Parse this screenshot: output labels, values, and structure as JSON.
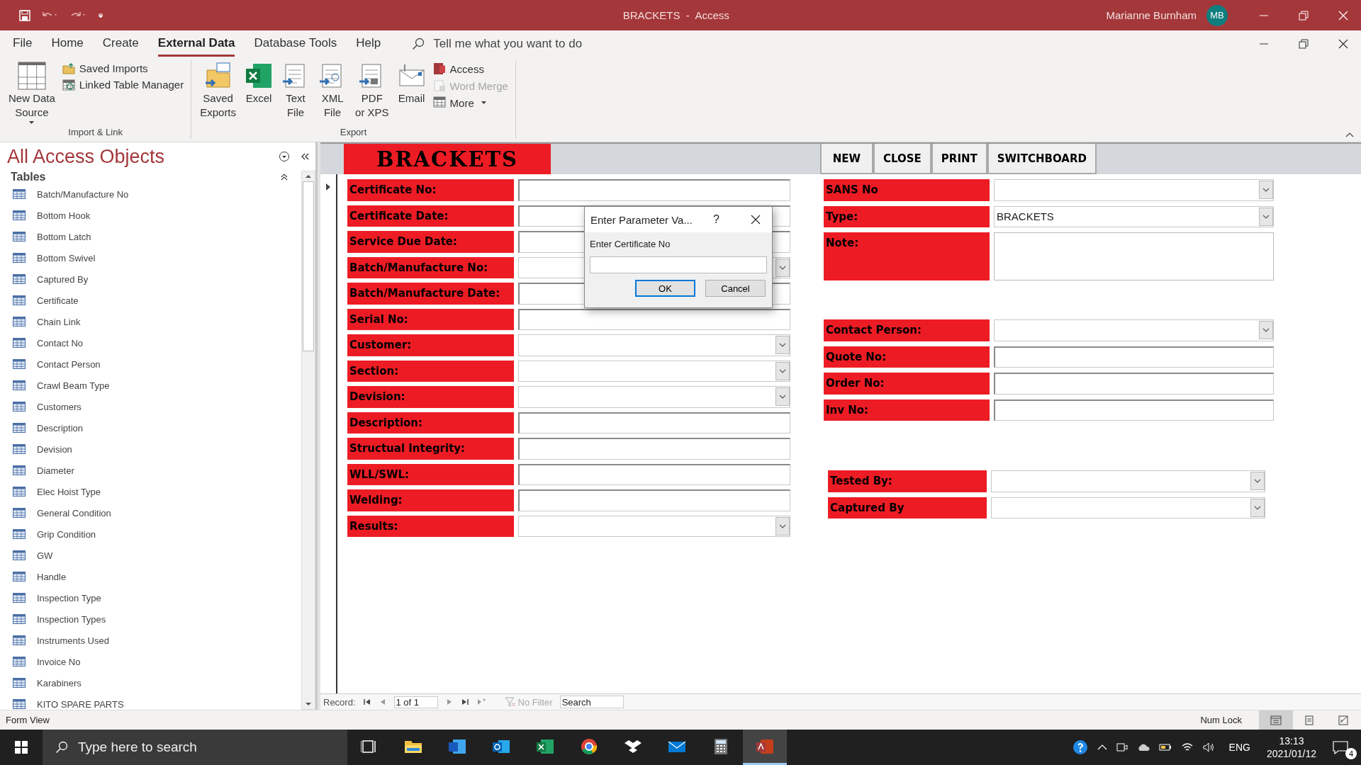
{
  "window": {
    "title": "BRACKETS  -  Access",
    "user": "Marianne Burnham",
    "user_initials": "MB"
  },
  "ribbon_tabs": [
    {
      "label": "File",
      "selected": false
    },
    {
      "label": "Home",
      "selected": false
    },
    {
      "label": "Create",
      "selected": false
    },
    {
      "label": "External Data",
      "selected": true
    },
    {
      "label": "Database Tools",
      "selected": false
    },
    {
      "label": "Help",
      "selected": false
    }
  ],
  "tell_me": {
    "placeholder": "Tell me what you want to do"
  },
  "ribbon_groups": [
    {
      "label": "Import & Link",
      "items": [
        {
          "label": "New Data\nSource",
          "kind": "large",
          "dropdown": true,
          "disabled": false
        },
        {
          "label": "Saved Imports",
          "kind": "small",
          "dropdown": false,
          "disabled": false
        },
        {
          "label": "Linked Table Manager",
          "kind": "small",
          "dropdown": false,
          "disabled": false
        }
      ]
    },
    {
      "label": "Export",
      "items": [
        {
          "label": "Saved\nExports",
          "kind": "large",
          "dropdown": false,
          "disabled": false
        },
        {
          "label": "Excel",
          "kind": "large",
          "dropdown": false,
          "disabled": false
        },
        {
          "label": "Text\nFile",
          "kind": "large",
          "dropdown": false,
          "disabled": false
        },
        {
          "label": "XML\nFile",
          "kind": "large",
          "dropdown": false,
          "disabled": false
        },
        {
          "label": "PDF\nor XPS",
          "kind": "large",
          "dropdown": false,
          "disabled": false
        },
        {
          "label": "Email",
          "kind": "large",
          "dropdown": false,
          "disabled": false
        },
        {
          "label": "Access",
          "kind": "small",
          "dropdown": false,
          "disabled": false
        },
        {
          "label": "Word Merge",
          "kind": "small",
          "dropdown": false,
          "disabled": true
        },
        {
          "label": "More",
          "kind": "small",
          "dropdown": true,
          "disabled": false
        }
      ]
    }
  ],
  "nav_pane": {
    "title": "All Access Objects",
    "section": "Tables",
    "items": [
      "Batch/Manufacture No",
      "Bottom Hook",
      "Bottom Latch",
      "Bottom Swivel",
      "Captured By",
      "Certificate",
      "Chain Link",
      "Contact No",
      "Contact Person",
      "Crawl Beam Type",
      "Customers",
      "Description",
      "Devision",
      "Diameter",
      "Elec Hoist Type",
      "General Condition",
      "Grip Condition",
      "GW",
      "Handle",
      "Inspection Type",
      "Inspection Types",
      "Instruments Used",
      "Invoice No",
      "Karabiners",
      "KITO SPARE PARTS"
    ]
  },
  "form": {
    "title": "BRACKETS",
    "buttons": [
      "NEW",
      "CLOSE",
      "PRINT",
      "SWITCHBOARD"
    ],
    "left_fields": [
      {
        "label": "Certificate No:",
        "kind": "text"
      },
      {
        "label": "Certificate Date:",
        "kind": "text"
      },
      {
        "label": "Service Due Date:",
        "kind": "text"
      },
      {
        "label": "Batch/Manufacture No:",
        "kind": "combo"
      },
      {
        "label": "Batch/Manufacture Date:",
        "kind": "text"
      },
      {
        "label": "Serial No:",
        "kind": "text"
      },
      {
        "label": "Customer:",
        "kind": "combo"
      },
      {
        "label": "Section:",
        "kind": "combo"
      },
      {
        "label": "Devision:",
        "kind": "combo"
      },
      {
        "label": "Description:",
        "kind": "text"
      },
      {
        "label": "Structual Integrity:",
        "kind": "text"
      },
      {
        "label": "WLL/SWL:",
        "kind": "text"
      },
      {
        "label": "Welding:",
        "kind": "text"
      },
      {
        "label": "Results:",
        "kind": "combo"
      }
    ],
    "right_fields": [
      {
        "label": "SANS No",
        "kind": "combo"
      },
      {
        "label": "Type:",
        "kind": "combo",
        "value": "BRACKETS"
      },
      {
        "label": "Note:",
        "kind": "memo"
      }
    ],
    "contact_fields": [
      {
        "label": "Contact Person:",
        "kind": "combo"
      },
      {
        "label": "Quote No:",
        "kind": "text"
      },
      {
        "label": "Order No:",
        "kind": "text"
      },
      {
        "label": "Inv No:",
        "kind": "text"
      }
    ],
    "staff_fields": [
      {
        "label": "Tested By:",
        "kind": "combo"
      },
      {
        "label": "Captured By",
        "kind": "combo"
      }
    ]
  },
  "record_nav": {
    "label": "Record:",
    "position": "1 of 1",
    "filter": "No Filter",
    "search_placeholder": "Search"
  },
  "dialog": {
    "title": "Enter Parameter Va...",
    "help": "?",
    "prompt": "Enter Certificate No",
    "buttons": [
      {
        "label": "OK",
        "default": true
      },
      {
        "label": "Cancel",
        "default": false
      }
    ]
  },
  "status_bar": {
    "left": "Form View",
    "right": "Num Lock",
    "views": [
      {
        "selected": true
      },
      {
        "selected": false
      },
      {
        "selected": false
      }
    ]
  },
  "taskbar": {
    "search_placeholder": "Type here to search",
    "apps": [
      {
        "kind": "taskview",
        "active": false
      },
      {
        "kind": "explorer",
        "active": false
      },
      {
        "kind": "word",
        "active": false
      },
      {
        "kind": "outlook",
        "active": false
      },
      {
        "kind": "excel",
        "active": false
      },
      {
        "kind": "chrome",
        "active": false
      },
      {
        "kind": "dropbox",
        "active": false
      },
      {
        "kind": "mail",
        "active": false
      },
      {
        "kind": "calculator",
        "active": false
      },
      {
        "kind": "access",
        "active": true
      }
    ],
    "language": "ENG",
    "time": "13:13",
    "date": "2021/01/12",
    "notifications": "4"
  }
}
